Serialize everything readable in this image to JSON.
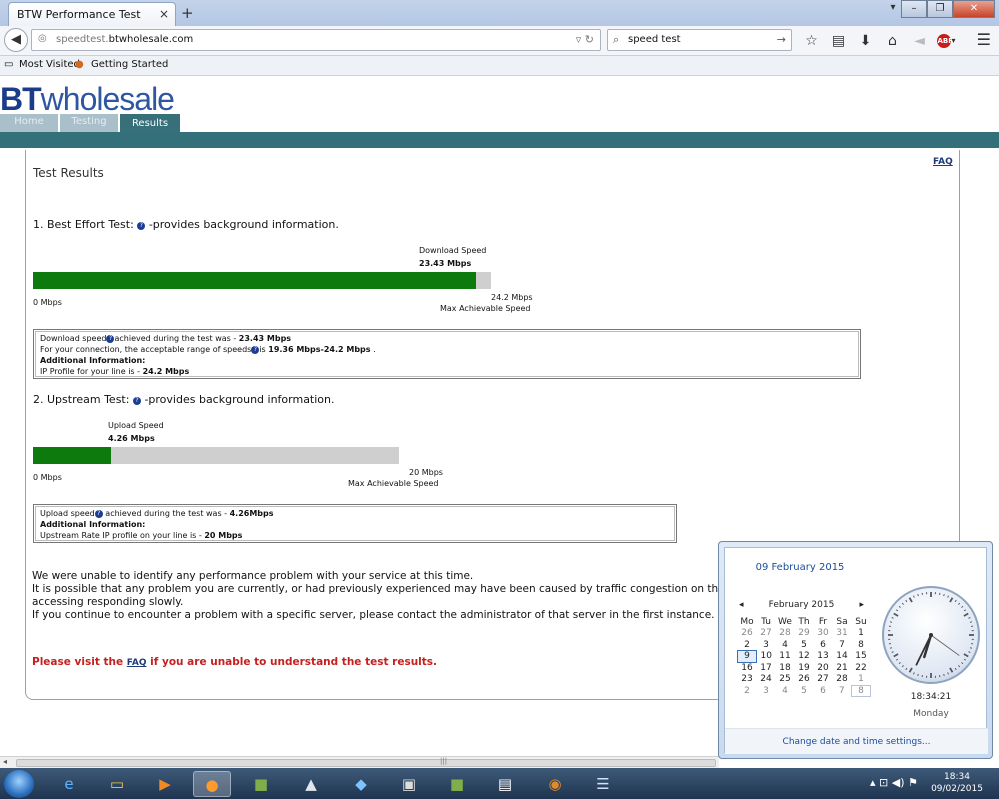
{
  "browser": {
    "tab_title": "BTW Performance Test",
    "tab_close": "×",
    "new_tab": "+",
    "url_prefix": "speedtest.",
    "url_host": "btwholesale.com",
    "search_value": "speed test",
    "bookmarks": [
      "Most Visited",
      "Getting Started"
    ],
    "icons": [
      "back-icon",
      "star-icon",
      "clipboard-icon",
      "download-icon",
      "home-icon",
      "share-icon",
      "adblock-icon",
      "menu-icon"
    ]
  },
  "site": {
    "logo_bt": "BT",
    "logo_rest": "wholesale",
    "nav": [
      "Home",
      "Testing",
      "Results"
    ],
    "faq": "FAQ",
    "title": "Test Results"
  },
  "best_effort": {
    "heading": "1. Best Effort Test:",
    "heading_tail": "-provides background information.",
    "label": "Download Speed",
    "speed_text": "23.43 Mbps",
    "zero_label": "0 Mbps",
    "max_text": "24.2 Mbps",
    "max_label": "Max Achievable Speed",
    "speed": 23.43,
    "max": 24.2,
    "box": {
      "l1a": "Download speed",
      "l1b": "achieved during the test was - ",
      "l1c": "23.43 Mbps",
      "l2a": "For your connection, the acceptable range of speeds",
      "l2b": "is ",
      "l2c": "19.36 Mbps-24.2 Mbps",
      "l2d": " .",
      "l3": "Additional Information:",
      "l4a": "IP Profile for your line is - ",
      "l4b": "24.2 Mbps"
    }
  },
  "upstream": {
    "heading": "2. Upstream Test:",
    "heading_tail": "-provides background information.",
    "label": "Upload Speed",
    "speed_text": "4.26 Mbps",
    "zero_label": "0 Mbps",
    "max_text": "20 Mbps",
    "max_label": "Max Achievable Speed",
    "speed": 4.26,
    "max": 20,
    "box": {
      "l1a": "Upload speed",
      "l1b": " achieved during the test was - ",
      "l1c": "4.26Mbps",
      "l2": "Additional Information:",
      "l3a": "Upstream Rate IP profile on your line is - ",
      "l3b": "20 Mbps"
    }
  },
  "message": {
    "line1": "We were unable to identify any performance problem with your service at this time.",
    "line2": "It is possible that any problem you are currently, or had previously experienced may have been caused by traffic congestion on the",
    "line3": "accessing responding slowly.",
    "line4": "If you continue to encounter a problem with a specific server, please contact the administrator of that server in the first instance.",
    "visit_a": "Please visit the ",
    "visit_link": "FAQ",
    "visit_b": " if you are unable to understand the test results."
  },
  "calendar": {
    "full_date": "09 February 2015",
    "month": "February 2015",
    "prev": "◂",
    "next": "▸",
    "weekdays": [
      "Mo",
      "Tu",
      "We",
      "Th",
      "Fr",
      "Sa",
      "Su"
    ],
    "weeks": [
      [
        "26",
        "27",
        "28",
        "29",
        "30",
        "31",
        "1"
      ],
      [
        "2",
        "3",
        "4",
        "5",
        "6",
        "7",
        "8"
      ],
      [
        "9",
        "10",
        "11",
        "12",
        "13",
        "14",
        "15"
      ],
      [
        "16",
        "17",
        "18",
        "19",
        "20",
        "21",
        "22"
      ],
      [
        "23",
        "24",
        "25",
        "26",
        "27",
        "28",
        "1"
      ],
      [
        "2",
        "3",
        "4",
        "5",
        "6",
        "7",
        "8"
      ]
    ],
    "time": "18:34:21",
    "day": "Monday",
    "settings_link": "Change date and time settings...",
    "clock": {
      "hours": 18,
      "minutes": 34,
      "seconds": 21
    }
  },
  "taskbar": {
    "time": "18:34",
    "date": "09/02/2015"
  }
}
